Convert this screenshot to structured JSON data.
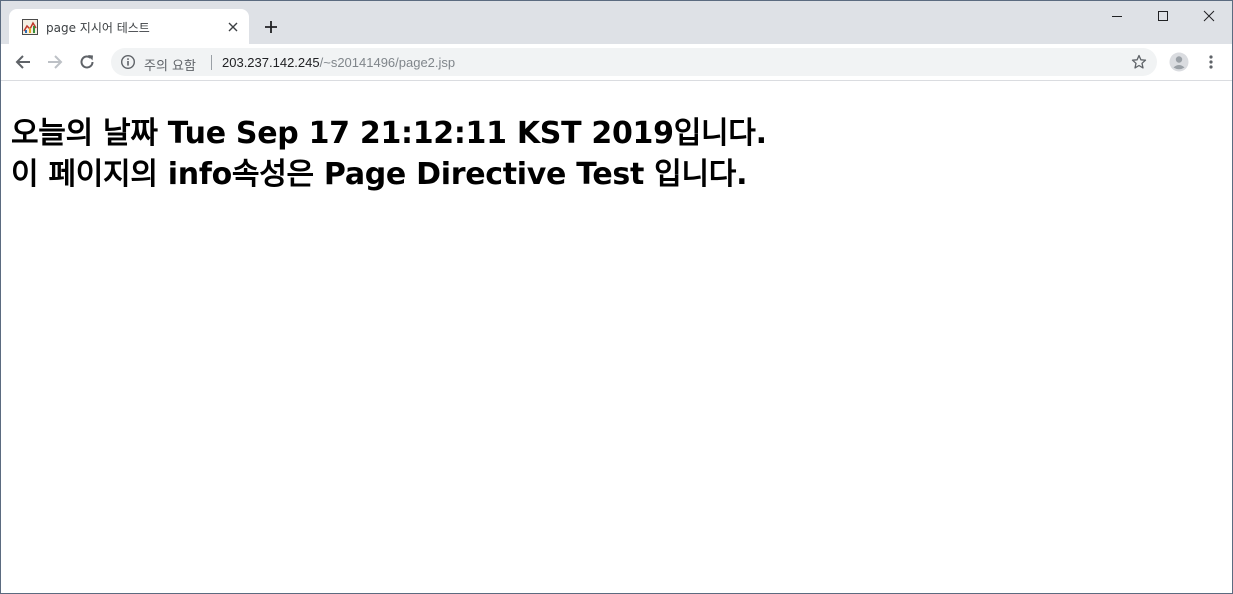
{
  "tab": {
    "title": "page 지시어 테스트",
    "favicon": "page-favicon-icon"
  },
  "window_controls": {
    "minimize": "minimize-icon",
    "maximize": "maximize-icon",
    "close": "close-icon"
  },
  "toolbar": {
    "back": "back-arrow-icon",
    "forward": "forward-arrow-icon",
    "reload": "reload-icon",
    "security_label": "주의 요함",
    "url_host": "203.237.142.245",
    "url_path": "/~s20141496/page2.jsp",
    "bookmark": "star-icon",
    "profile": "profile-icon",
    "menu": "kebab-menu-icon"
  },
  "page": {
    "line1": "오늘의 날짜 Tue Sep 17 21:12:11 KST 2019입니다.",
    "line2": "이 페이지의 info속성은 Page Directive Test 입니다."
  },
  "colors": {
    "tabstrip": "#dee1e6",
    "omnibox": "#f1f3f4",
    "icon": "#5f6368",
    "text": "#000000"
  }
}
